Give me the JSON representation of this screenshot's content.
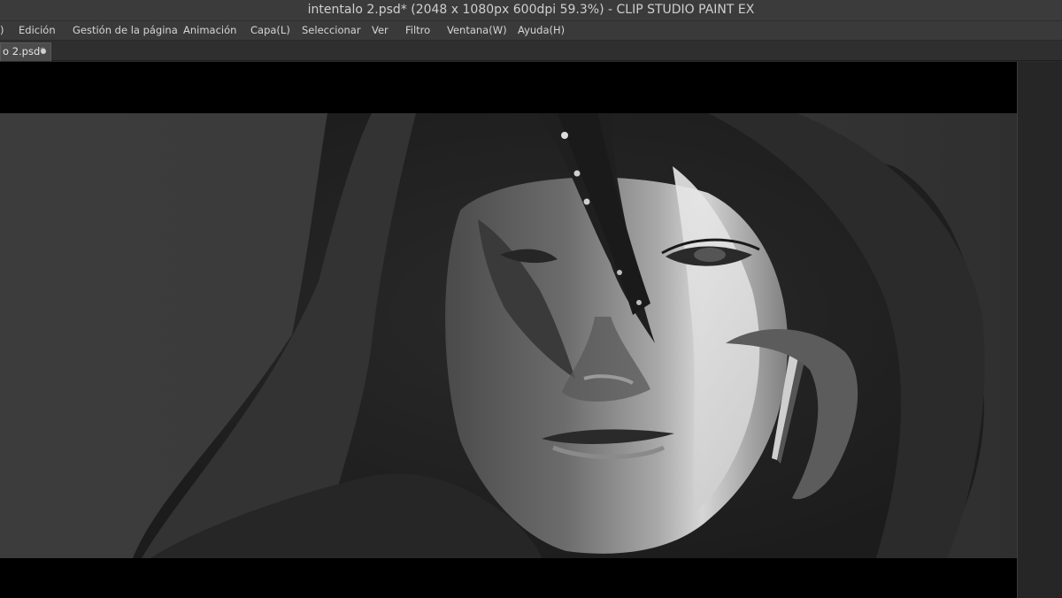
{
  "window": {
    "title": "intentalo 2.psd* (2048 x 1080px 600dpi 59.3%)  - CLIP STUDIO PAINT EX"
  },
  "menu": {
    "items": [
      {
        "label": ")"
      },
      {
        "label": "Edición"
      },
      {
        "label": "Gestión de la página"
      },
      {
        "label": "Animación"
      },
      {
        "label": "Capa(L)"
      },
      {
        "label": "Seleccionar"
      },
      {
        "label": "Ver"
      },
      {
        "label": "Filtro"
      },
      {
        "label": "Ventana(W)"
      },
      {
        "label": "Ayuda(H)"
      }
    ]
  },
  "document_tab": {
    "label": "o 2.psd*"
  },
  "colors": {
    "titlebar_bg": "#3b3b3b",
    "menubar_bg": "#3a3a3a",
    "tabstrip_bg": "#2f2f2f",
    "letterbox": "#000000",
    "canvas_bg": "#3a3a3a"
  }
}
